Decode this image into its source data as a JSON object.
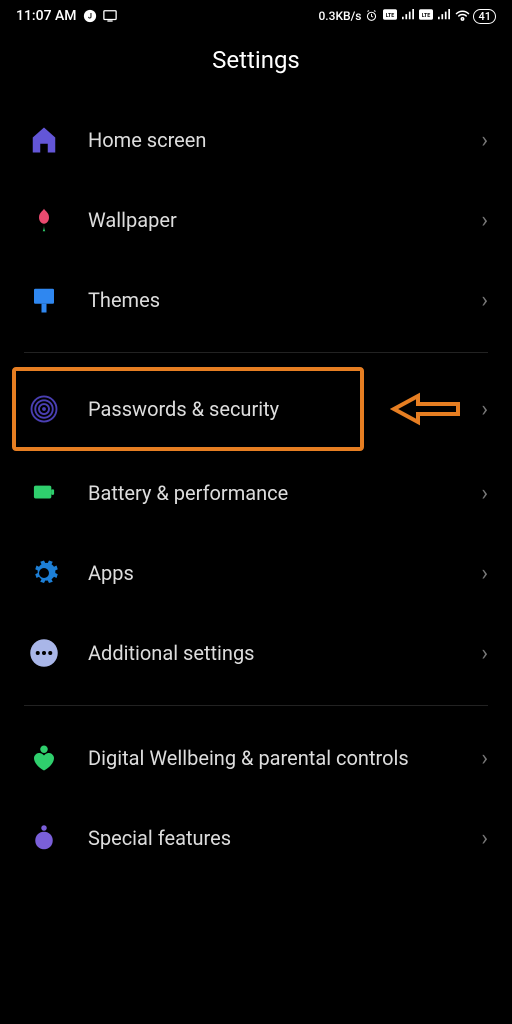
{
  "status": {
    "time": "11:07 AM",
    "data_rate": "0.3KB/s",
    "battery": "41"
  },
  "title": "Settings",
  "items": {
    "home": "Home screen",
    "wallpaper": "Wallpaper",
    "themes": "Themes",
    "passwords": "Passwords & security",
    "battery": "Battery & performance",
    "apps": "Apps",
    "additional": "Additional settings",
    "wellbeing": "Digital Wellbeing & parental controls",
    "special": "Special features"
  },
  "colors": {
    "home_icon": "#6356d7",
    "wallpaper_icon": "#e94a6f",
    "themes_icon": "#2f87f0",
    "fingerprint_icon": "#4a3fb3",
    "battery_icon": "#2fcf6d",
    "apps_icon": "#1d7fd6",
    "additional_icon": "#a9b6e8",
    "wellbeing_icon": "#2fcf6d",
    "special_icon": "#7a5fd9",
    "highlight": "#e67e22"
  }
}
